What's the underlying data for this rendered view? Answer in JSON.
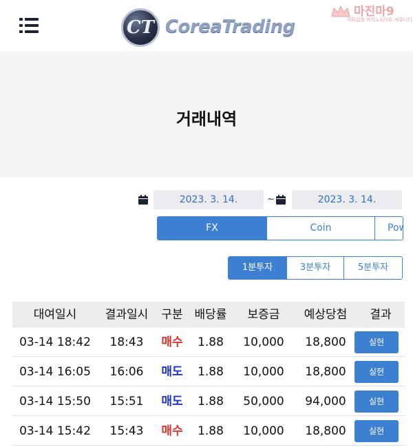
{
  "header": {
    "logo_mark": "CT",
    "logo_text": "CoreaTrading",
    "watermark_main": "마진마9",
    "watermark_sub": "먹튀검증 카지노사이트 커뮤니티"
  },
  "page_title": "거래내역",
  "date_filter": {
    "start_date": "2023. 3. 14.",
    "separator": "~",
    "end_date": "2023. 3. 14."
  },
  "market_tabs": [
    {
      "label": "FX",
      "active": true
    },
    {
      "label": "Coin",
      "active": false
    },
    {
      "label": "Pow",
      "active": false
    }
  ],
  "period_tabs": [
    {
      "label": "1분투자",
      "active": true
    },
    {
      "label": "3분투자",
      "active": false
    },
    {
      "label": "5분투자",
      "active": false
    }
  ],
  "table": {
    "headers": [
      "대여일시",
      "결과일시",
      "구분",
      "배당률",
      "보증금",
      "예상당첨",
      "결과"
    ],
    "rows": [
      {
        "rent_time": "03-14 18:42",
        "result_time": "18:43",
        "type": "매수",
        "odds": "1.88",
        "deposit": "10,000",
        "expected": "18,800",
        "result": "실현"
      },
      {
        "rent_time": "03-14 16:05",
        "result_time": "16:06",
        "type": "매도",
        "odds": "1.88",
        "deposit": "10,000",
        "expected": "18,800",
        "result": "실현"
      },
      {
        "rent_time": "03-14 15:50",
        "result_time": "15:51",
        "type": "매도",
        "odds": "1.88",
        "deposit": "50,000",
        "expected": "94,000",
        "result": "실현"
      },
      {
        "rent_time": "03-14 15:42",
        "result_time": "15:43",
        "type": "매수",
        "odds": "1.88",
        "deposit": "10,000",
        "expected": "18,800",
        "result": "실현"
      }
    ]
  },
  "colors": {
    "accent": "#3d7fd1",
    "buy": "#e0312a",
    "sell": "#1b33c9"
  }
}
